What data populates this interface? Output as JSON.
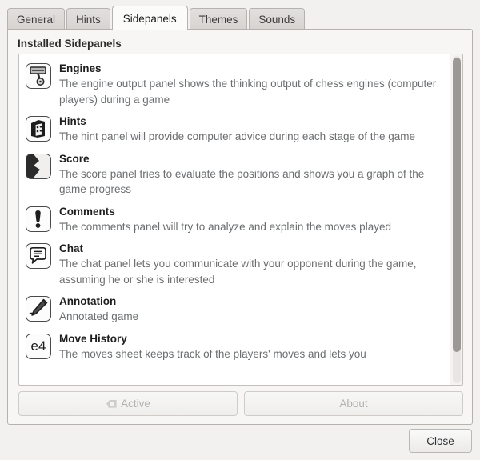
{
  "window": {
    "tabs": [
      {
        "label": "General",
        "active": false
      },
      {
        "label": "Hints",
        "active": false
      },
      {
        "label": "Sidepanels",
        "active": true
      },
      {
        "label": "Themes",
        "active": false
      },
      {
        "label": "Sounds",
        "active": false
      }
    ],
    "close_label": "Close"
  },
  "panel": {
    "section_title": "Installed Sidepanels",
    "items": [
      {
        "icon": "piston-icon",
        "title": "Engines",
        "description": "The engine output panel shows the thinking output of chess engines (computer players) during a game"
      },
      {
        "icon": "dice-icon",
        "title": "Hints",
        "description": "The hint panel will provide computer advice during each stage of the game"
      },
      {
        "icon": "score-graph-icon",
        "title": "Score",
        "description": "The score panel tries to evaluate the positions and shows you a graph of the game progress"
      },
      {
        "icon": "exclamation-icon",
        "title": "Comments",
        "description": "The comments panel will try to analyze and explain the moves played"
      },
      {
        "icon": "speech-bubble-icon",
        "title": "Chat",
        "description": "The chat panel lets you communicate with your opponent during the game, assuming he or she is interested"
      },
      {
        "icon": "pencil-icon",
        "title": "Annotation",
        "description": "Annotated game"
      },
      {
        "icon": "e4-icon",
        "title": "Move History",
        "description": "The moves sheet keeps track of the players' moves and lets you"
      }
    ],
    "buttons": {
      "active_label": "Active",
      "about_label": "About"
    }
  },
  "colors": {
    "window_bg": "#f2f1f0",
    "page_bg": "#f7f6f5",
    "list_bg": "#ffffff",
    "title_text": "#1d1d1d",
    "desc_text": "#6b6e70",
    "scrollbar_thumb": "#9a9996",
    "border": "#b6b2ae"
  }
}
